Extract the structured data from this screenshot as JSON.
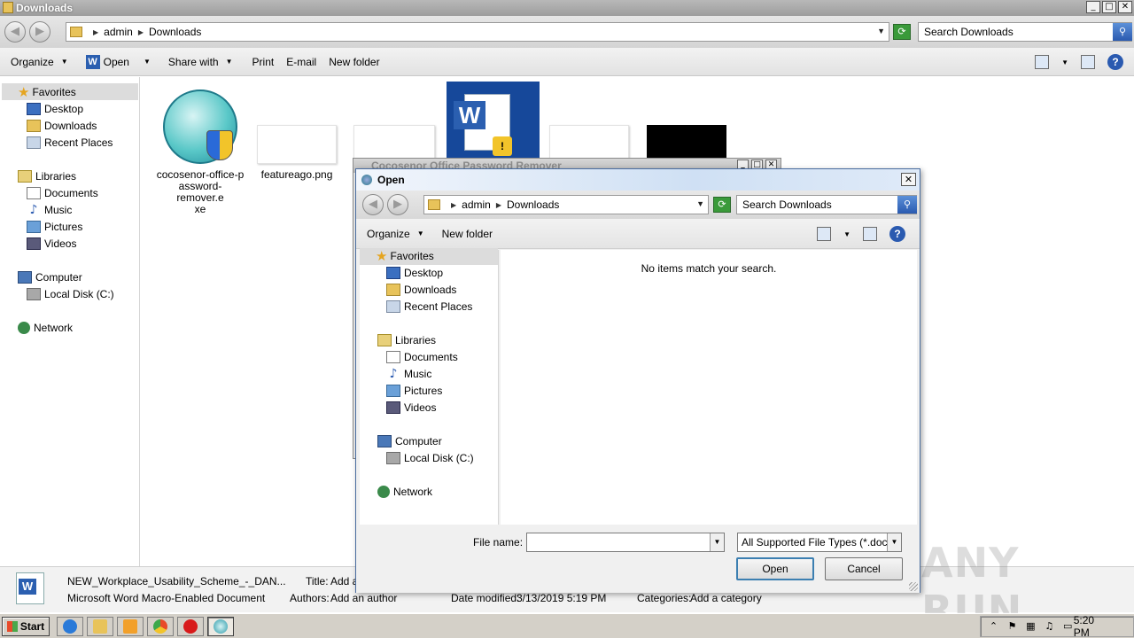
{
  "explorer": {
    "title": "Downloads",
    "window_buttons": [
      "_",
      "□",
      "✕"
    ],
    "nav_back": "◀",
    "nav_forward": "▶",
    "address": {
      "crumbs": [
        "admin",
        "Downloads"
      ]
    },
    "search_placeholder": "Search Downloads",
    "toolbar": {
      "organize": "Organize",
      "open": "Open",
      "share_with": "Share with",
      "print": "Print",
      "email": "E-mail",
      "new_folder": "New folder"
    },
    "nav": {
      "favorites": "Favorites",
      "desktop": "Desktop",
      "downloads": "Downloads",
      "recent_places": "Recent Places",
      "libraries": "Libraries",
      "documents": "Documents",
      "music": "Music",
      "pictures": "Pictures",
      "videos": "Videos",
      "computer": "Computer",
      "local_disk": "Local Disk (C:)",
      "network": "Network"
    },
    "files": [
      {
        "name": "cocosenor-office-password-remover.exe",
        "name_lines": [
          "cocosenor-office-p",
          "assword-remover.e",
          "xe"
        ]
      },
      {
        "name": "featureago.png"
      }
    ],
    "details": {
      "file_name": "NEW_Workplace_Usability_Scheme_-_DAN...",
      "file_type": "Microsoft Word Macro-Enabled Document",
      "title_label": "Title:",
      "title_value": "Add a",
      "authors_label": "Authors:",
      "authors_value": "Add an author",
      "date_label": "Date modified:",
      "date_value": "3/13/2019 5:19 PM",
      "categories_label": "Categories:",
      "categories_value": "Add a category"
    }
  },
  "background_window": {
    "title": "Cocosenor Office Password Remover"
  },
  "open_dialog": {
    "title": "Open",
    "close": "✕",
    "address": {
      "crumbs": [
        "admin",
        "Downloads"
      ]
    },
    "search_placeholder": "Search Downloads",
    "toolbar": {
      "organize": "Organize",
      "new_folder": "New folder"
    },
    "nav": {
      "favorites": "Favorites",
      "desktop": "Desktop",
      "downloads": "Downloads",
      "recent_places": "Recent Places",
      "libraries": "Libraries",
      "documents": "Documents",
      "music": "Music",
      "pictures": "Pictures",
      "videos": "Videos",
      "computer": "Computer",
      "local_disk": "Local Disk (C:)",
      "network": "Network"
    },
    "empty_message": "No items match your search.",
    "file_name_label": "File name:",
    "file_name_value": "",
    "file_type_value": "All Supported File Types (*.doc;",
    "open_button": "Open",
    "cancel_button": "Cancel"
  },
  "taskbar": {
    "start": "Start",
    "clock": "5:20 PM"
  },
  "watermark": "ANY RUN"
}
